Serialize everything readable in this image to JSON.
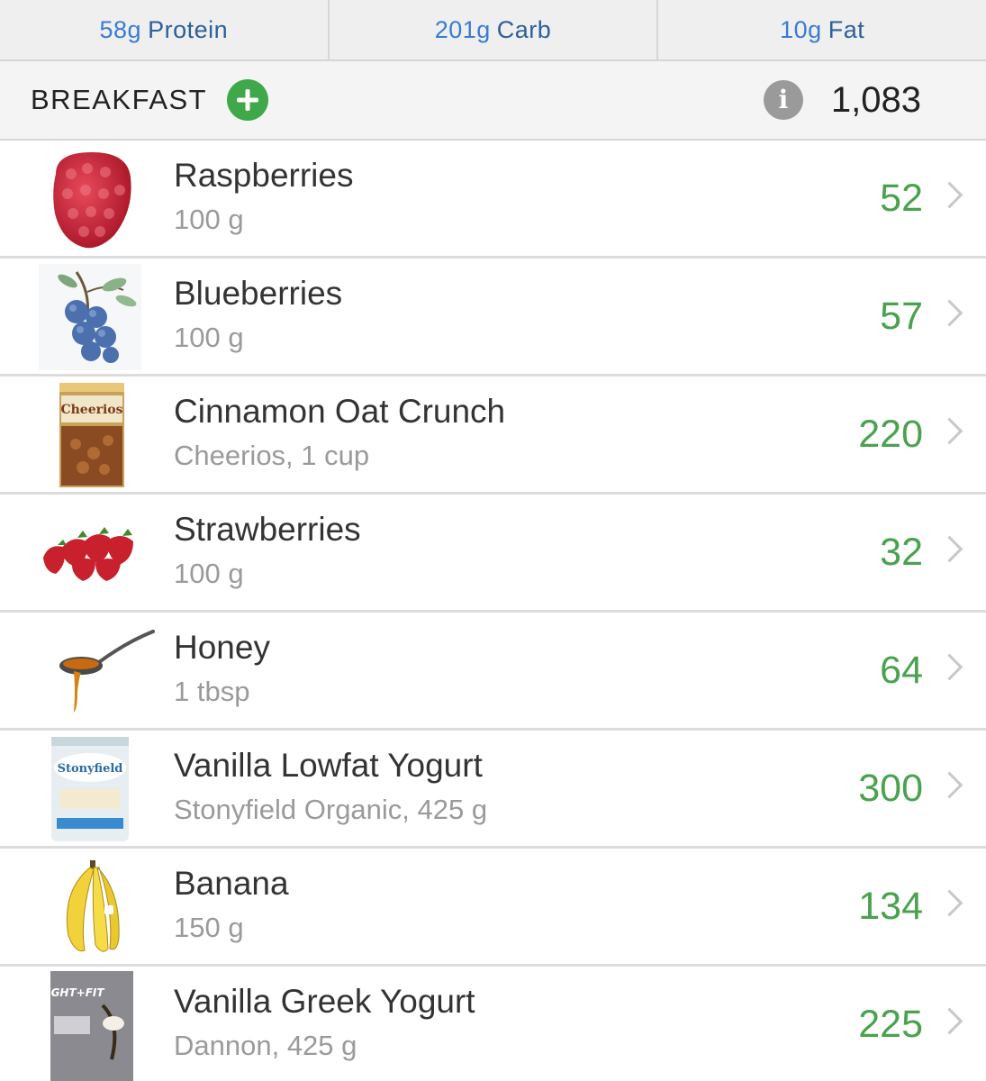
{
  "macros": [
    {
      "amount": "58g",
      "name": "Protein"
    },
    {
      "amount": "201g",
      "name": "Carb"
    },
    {
      "amount": "10g",
      "name": "Fat"
    }
  ],
  "meal": {
    "title": "BREAKFAST",
    "total_calories": "1,083",
    "info_icon_glyph": "i"
  },
  "foods": [
    {
      "name": "Raspberries",
      "detail": "100 g",
      "calories": "52",
      "icon": "raspberry-icon"
    },
    {
      "name": "Blueberries",
      "detail": "100 g",
      "calories": "57",
      "icon": "blueberry-icon"
    },
    {
      "name": "Cinnamon Oat Crunch",
      "detail": "Cheerios, 1 cup",
      "calories": "220",
      "icon": "cereal-box-icon",
      "box_text": "Cheerios"
    },
    {
      "name": "Strawberries",
      "detail": "100 g",
      "calories": "32",
      "icon": "strawberry-icon"
    },
    {
      "name": "Honey",
      "detail": "1 tbsp",
      "calories": "64",
      "icon": "honey-spoon-icon"
    },
    {
      "name": "Vanilla Lowfat Yogurt",
      "detail": "Stonyfield Organic, 425 g",
      "calories": "300",
      "icon": "yogurt-tub-icon",
      "box_text": "Stonyfield"
    },
    {
      "name": "Banana",
      "detail": "150 g",
      "calories": "134",
      "icon": "banana-icon"
    },
    {
      "name": "Vanilla Greek Yogurt",
      "detail": "Dannon, 425 g",
      "calories": "225",
      "icon": "greek-yogurt-icon",
      "box_text": "LIGHT+FIT"
    }
  ],
  "colors": {
    "accent_green": "#4aa24f",
    "add_button_green": "#3ea84a",
    "macro_blue": "#3a7bd5"
  }
}
